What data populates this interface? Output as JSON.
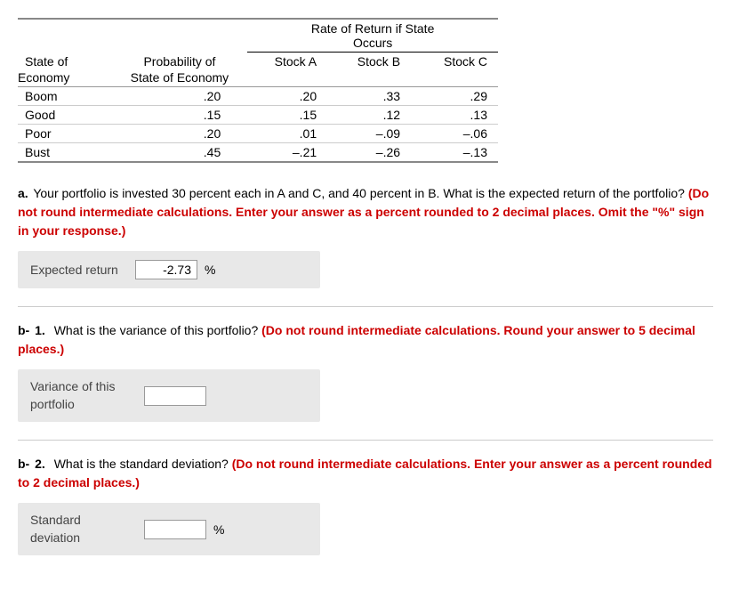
{
  "table": {
    "main_header": {
      "rate_label": "Rate of Return if State",
      "occurs_label": "Occurs"
    },
    "sub_header": {
      "state_of": "State of",
      "probability_of": "Probability of",
      "stock_a": "Stock A",
      "stock_b": "Stock B",
      "stock_c": "Stock C"
    },
    "row_headers": {
      "economy": "Economy",
      "state_of_economy": "State of Economy"
    },
    "rows": [
      {
        "economy": "Boom",
        "probability": ".20",
        "stock_a": ".20",
        "stock_b": ".33",
        "stock_c": ".29"
      },
      {
        "economy": "Good",
        "probability": ".15",
        "stock_a": ".15",
        "stock_b": ".12",
        "stock_c": ".13"
      },
      {
        "economy": "Poor",
        "probability": ".20",
        "stock_a": ".01",
        "stock_b": "–.09",
        "stock_c": "–.06"
      },
      {
        "economy": "Bust",
        "probability": ".45",
        "stock_a": "–.21",
        "stock_b": "–.26",
        "stock_c": "–.13"
      }
    ]
  },
  "questions": {
    "a": {
      "label": "a.",
      "text_plain": "Your portfolio is invested 30 percent each in A and C, and 40 percent in B. What is the expected return of the portfolio?",
      "text_bold_red": "(Do not round intermediate calculations. Enter your answer as a percent rounded to 2 decimal places. Omit the \"%\" sign in your response.)",
      "answer_label": "Expected return",
      "answer_value": "-2.73",
      "answer_unit": "%"
    },
    "b1": {
      "label_letter": "b-",
      "label_number": "1.",
      "text_plain": "What is the variance of this portfolio?",
      "text_bold_red": "(Do not round intermediate calculations. Round your answer to 5 decimal places.)",
      "answer_label_line1": "Variance of this",
      "answer_label_line2": "portfolio",
      "answer_value": ""
    },
    "b2": {
      "label_letter": "b-",
      "label_number": "2.",
      "text_plain": "What is the standard deviation?",
      "text_bold_red": "(Do not round intermediate calculations. Enter your answer as a percent rounded to 2 decimal places.)",
      "answer_label_line1": "Standard",
      "answer_label_line2": "deviation",
      "answer_value": "",
      "answer_unit": "%"
    }
  }
}
